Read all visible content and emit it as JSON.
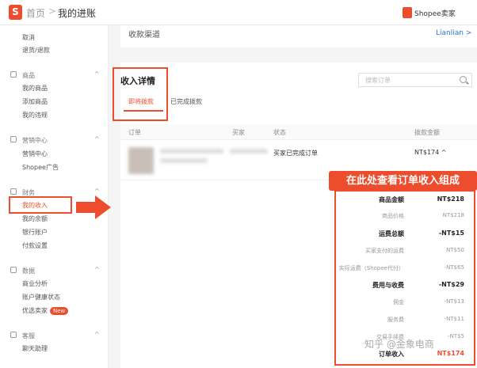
{
  "header": {
    "logo_letter": "S",
    "home": "首页",
    "separator": ">",
    "current": "我的进账",
    "seller": "Shopee卖家"
  },
  "sidebar": {
    "top_items": [
      "取消",
      "退货/退款"
    ],
    "sections": [
      {
        "title": "商品",
        "items": [
          "我的商品",
          "添加商品",
          "我的违规"
        ]
      },
      {
        "title": "营销中心",
        "items": [
          "营销中心",
          "Shopee广告"
        ]
      },
      {
        "title": "财务",
        "items": [
          "我的收入",
          "我的余额",
          "银行账户",
          "付款设置"
        ]
      },
      {
        "title": "数据",
        "items": [
          "商业分析",
          "账户健康状态",
          "优选卖家"
        ]
      },
      {
        "title": "客服",
        "items": [
          "聊天助理"
        ]
      }
    ],
    "new_badge": "New",
    "chevron": "^"
  },
  "channel": {
    "label": "收款渠道",
    "link": "Lianlian >"
  },
  "income": {
    "title": "收入详情",
    "tabs": [
      "即将拨款",
      "已完成拨款"
    ],
    "search_placeholder": "搜索订单",
    "columns": [
      "订单",
      "买家",
      "状态",
      "拨款金额"
    ],
    "row": {
      "status": "买家已完成订单",
      "amount": "NT$174 ^"
    }
  },
  "callout": "在此处查看订单收入组成",
  "breakdown": [
    {
      "label": "商品金额",
      "value": "NT$218",
      "style": "bold"
    },
    {
      "label": "商品价格",
      "value": "NT$218",
      "style": "sub"
    },
    {
      "label": "运费总额",
      "value": "-NT$15",
      "style": "bold"
    },
    {
      "label": "买家支付的运费",
      "value": "NT$50",
      "style": "sub"
    },
    {
      "label": "实际运费（Shopee代付）",
      "value": "-NT$65",
      "style": "sub"
    },
    {
      "label": "费用与收费",
      "value": "-NT$29",
      "style": "bold"
    },
    {
      "label": "佣金",
      "value": "-NT$13",
      "style": "sub"
    },
    {
      "label": "服务费",
      "value": "-NT$11",
      "style": "sub"
    },
    {
      "label": "交易手续费",
      "value": "-NT$5",
      "style": "sub"
    },
    {
      "label": "订单收入",
      "value": "NT$174",
      "style": "total"
    }
  ],
  "watermark": "知乎 @金象电商",
  "colors": {
    "brand": "#ee4d2d",
    "link": "#2673dd"
  }
}
